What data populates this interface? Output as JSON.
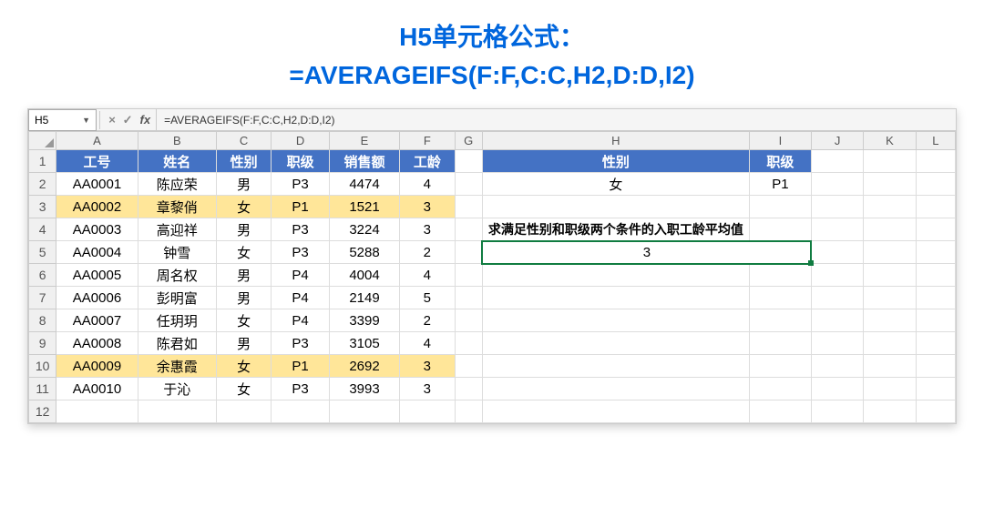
{
  "title": {
    "line1": "H5单元格公式：",
    "line2": "=AVERAGEIFS(F:F,C:C,H2,D:D,I2)"
  },
  "namebox": "H5",
  "formula_bar": "=AVERAGEIFS(F:F,C:C,H2,D:D,I2)",
  "fx_label": "fx",
  "columns": [
    "A",
    "B",
    "C",
    "D",
    "E",
    "F",
    "G",
    "H",
    "I",
    "J",
    "K",
    "L"
  ],
  "header_main": {
    "A": "工号",
    "B": "姓名",
    "C": "性别",
    "D": "职级",
    "E": "销售额",
    "F": "工龄"
  },
  "header_side": {
    "H": "性别",
    "I": "职级"
  },
  "criteria": {
    "H": "女",
    "I": "P1"
  },
  "instruction": "求满足性别和职级两个条件的入职工龄平均值",
  "result": "3",
  "rows": [
    {
      "id": "AA0001",
      "name": "陈应荣",
      "sex": "男",
      "rank": "P3",
      "sales": "4474",
      "years": "4",
      "hl": false
    },
    {
      "id": "AA0002",
      "name": "章黎俏",
      "sex": "女",
      "rank": "P1",
      "sales": "1521",
      "years": "3",
      "hl": true
    },
    {
      "id": "AA0003",
      "name": "高迎祥",
      "sex": "男",
      "rank": "P3",
      "sales": "3224",
      "years": "3",
      "hl": false
    },
    {
      "id": "AA0004",
      "name": "钟雪",
      "sex": "女",
      "rank": "P3",
      "sales": "5288",
      "years": "2",
      "hl": false
    },
    {
      "id": "AA0005",
      "name": "周名权",
      "sex": "男",
      "rank": "P4",
      "sales": "4004",
      "years": "4",
      "hl": false
    },
    {
      "id": "AA0006",
      "name": "彭明富",
      "sex": "男",
      "rank": "P4",
      "sales": "2149",
      "years": "5",
      "hl": false
    },
    {
      "id": "AA0007",
      "name": "任玥玥",
      "sex": "女",
      "rank": "P4",
      "sales": "3399",
      "years": "2",
      "hl": false
    },
    {
      "id": "AA0008",
      "name": "陈君如",
      "sex": "男",
      "rank": "P3",
      "sales": "3105",
      "years": "4",
      "hl": false
    },
    {
      "id": "AA0009",
      "name": "余惠霞",
      "sex": "女",
      "rank": "P1",
      "sales": "2692",
      "years": "3",
      "hl": true
    },
    {
      "id": "AA0010",
      "name": "于沁",
      "sex": "女",
      "rank": "P3",
      "sales": "3993",
      "years": "3",
      "hl": false
    }
  ]
}
